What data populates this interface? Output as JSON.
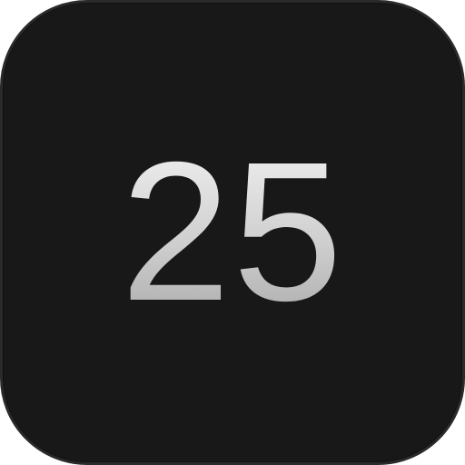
{
  "app_icon": {
    "number_label": "25",
    "colors": {
      "tile_background": "#181818",
      "tile_border": "#2a2a2a",
      "number_gradient_top": "#f2f2f2",
      "number_gradient_bottom": "#a9a9a9"
    }
  }
}
